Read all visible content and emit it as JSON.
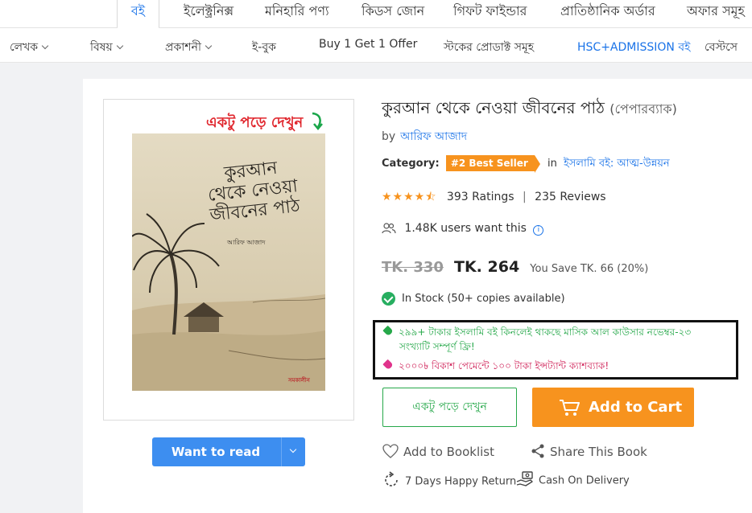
{
  "top_nav": {
    "tabs": [
      {
        "label": "বই",
        "active": true
      },
      {
        "label": "ইলেক্ট্রনিক্স"
      },
      {
        "label": "মনিহারি পণ্য"
      },
      {
        "label": "কিডস জোন"
      },
      {
        "label": "গিফট ফাইন্ডার"
      },
      {
        "label": "প্রাতিষ্ঠানিক অর্ডার"
      },
      {
        "label": "অফার সমূহ"
      }
    ]
  },
  "sub_nav": {
    "items": [
      {
        "label": "লেখক"
      },
      {
        "label": "বিষয়"
      },
      {
        "label": "প্রকাশনী"
      },
      {
        "label": "ই-বুক"
      },
      {
        "label": "Buy 1 Get 1 Offer"
      },
      {
        "label": "স্টকের প্রোডাক্ট সমূহ"
      },
      {
        "label": "HSC+ADMISSION বই"
      },
      {
        "label": "বেস্টসে"
      }
    ]
  },
  "book": {
    "peek_label": "একটু পড়ে দেখুন",
    "cover": {
      "title": "কুরআন থেকে নেওয়া জীবনের পাঠ",
      "author": "আরিফ আজাদ",
      "publisher": "সমকালীন"
    },
    "want_to_read": "Want to read",
    "title": "কুরআন থেকে নেওয়া জীবনের পাঠ",
    "format": "(পেপারব্যাক)",
    "by": "by",
    "author": "আরিফ আজাদ",
    "category_label": "Category:",
    "badge": "#2 Best Seller",
    "in": "in",
    "category": "ইসলামি বই: আত্ম-উন্নয়ন",
    "rating_value": 4.5,
    "stars": "★★★★⯪",
    "ratings": "393 Ratings",
    "separator": "|",
    "reviews": "235 Reviews",
    "want_count": "1.48K users want this",
    "info_glyph": "i",
    "old_price": "TK. 330",
    "price": "TK. 264",
    "you_save": "You Save TK. 66 (20%)",
    "stock": "In Stock (50+ copies available)",
    "offers": {
      "offer1_line1": "২৯৯+ টাকার ইসলামি বই কিনলেই থাকছে মাসিক আল কাউসার নভেম্বর-২৩",
      "offer1_line2": "সংখ্যাটি সম্পূর্ণ ফ্রি!",
      "offer2": "২০০০৳ বিকাশ পেমেন্টে ১০০ টাকা ইন্সট্যান্ট ক্যাশব্যাক!"
    },
    "read_button": "একটু পড়ে দেখুন",
    "cart_button": "Add to Cart",
    "booklist": "Add to Booklist",
    "share": "Share This Book",
    "returns": "7 Days Happy Return",
    "cod": "Cash On Delivery"
  },
  "colors": {
    "brand_blue": "#1a73e8",
    "orange": "#f7931e",
    "green": "#26a84a",
    "pink": "#d0245a"
  }
}
